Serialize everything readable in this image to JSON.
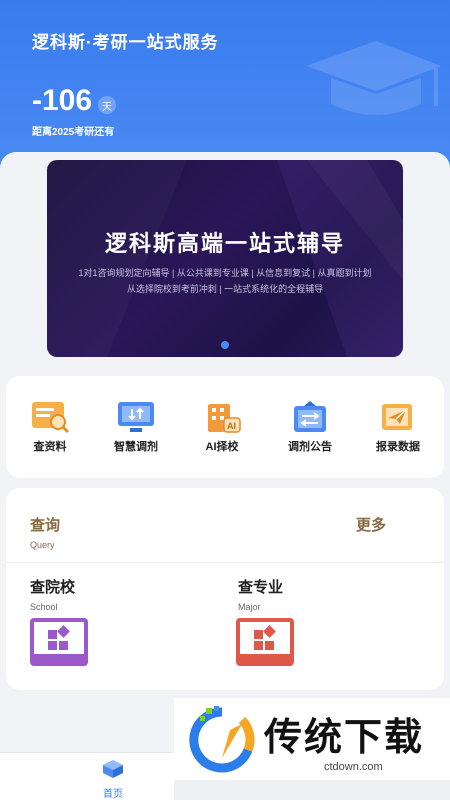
{
  "header": {
    "title": "逻科斯·考研一站式服务",
    "countdown_value": "-106",
    "countdown_unit": "天",
    "countdown_label": "距离2025考研还有"
  },
  "banner": {
    "title": "逻科斯高端一站式辅导",
    "line1": "1对1咨询规划定向辅导 | 从公共课到专业课 | 从信息到复试 | 从真题到计划",
    "line2": "从选择院校到考前冲刺 | 一站式系统化的全程辅导",
    "active_slide": 1,
    "slide_count": 1
  },
  "functions": [
    {
      "label": "查资料",
      "icon": "search-document-icon"
    },
    {
      "label": "智慧调剂",
      "icon": "monitor-transfer-icon"
    },
    {
      "label": "AI择校",
      "icon": "ai-building-icon"
    },
    {
      "label": "调剂公告",
      "icon": "announcement-transfer-icon"
    },
    {
      "label": "报录数据",
      "icon": "data-paper-plane-icon"
    }
  ],
  "query": {
    "title": "查询",
    "subtitle": "Query",
    "more": "更多",
    "items": [
      {
        "title": "查院校",
        "subtitle": "School",
        "icon": "school-grid-icon",
        "color": "#9b59c9"
      },
      {
        "title": "查专业",
        "subtitle": "Major",
        "icon": "major-grid-icon",
        "color": "#e0584a"
      }
    ]
  },
  "watermark": {
    "text": "传统下载",
    "domain": "ctdown.com"
  },
  "tabbar": {
    "home_label": "首页"
  },
  "colors": {
    "header_blue": "#3a7cf0",
    "banner_bg": "#1d1347",
    "query_accent": "#8b6a43"
  }
}
